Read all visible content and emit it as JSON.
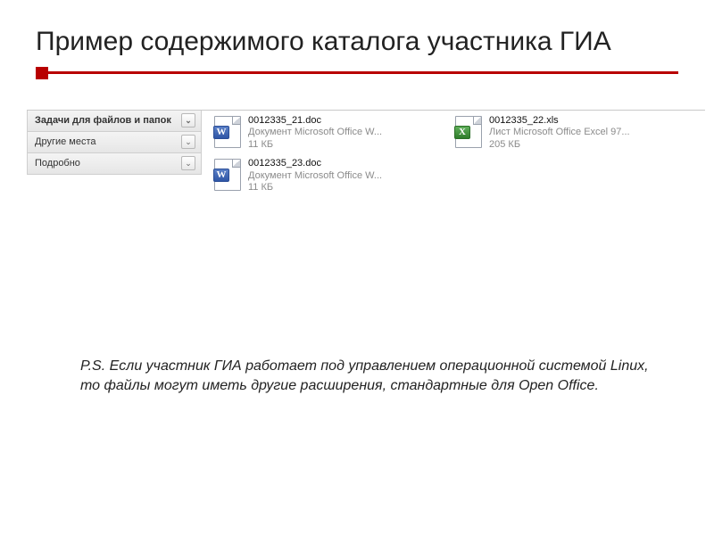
{
  "title": "Пример содержимого каталога участника ГИА",
  "sidepanel": {
    "tasks": {
      "label": "Задачи для файлов и папок"
    },
    "places": {
      "label": "Другие места"
    },
    "details": {
      "label": "Подробно"
    }
  },
  "files": [
    {
      "name": "0012335_21.doc",
      "type": "Документ Microsoft Office W...",
      "size": "11 КБ",
      "kind": "word",
      "badge": "W"
    },
    {
      "name": "0012335_22.xls",
      "type": "Лист Microsoft Office Excel 97...",
      "size": "205 КБ",
      "kind": "excel",
      "badge": "X"
    },
    {
      "name": "0012335_23.doc",
      "type": "Документ Microsoft Office W...",
      "size": "11 КБ",
      "kind": "word",
      "badge": "W"
    }
  ],
  "ps": "P.S. Если участник ГИА работает под управлением операционной системой Linux, то файлы могут иметь другие расширения, стандартные для Open Office."
}
